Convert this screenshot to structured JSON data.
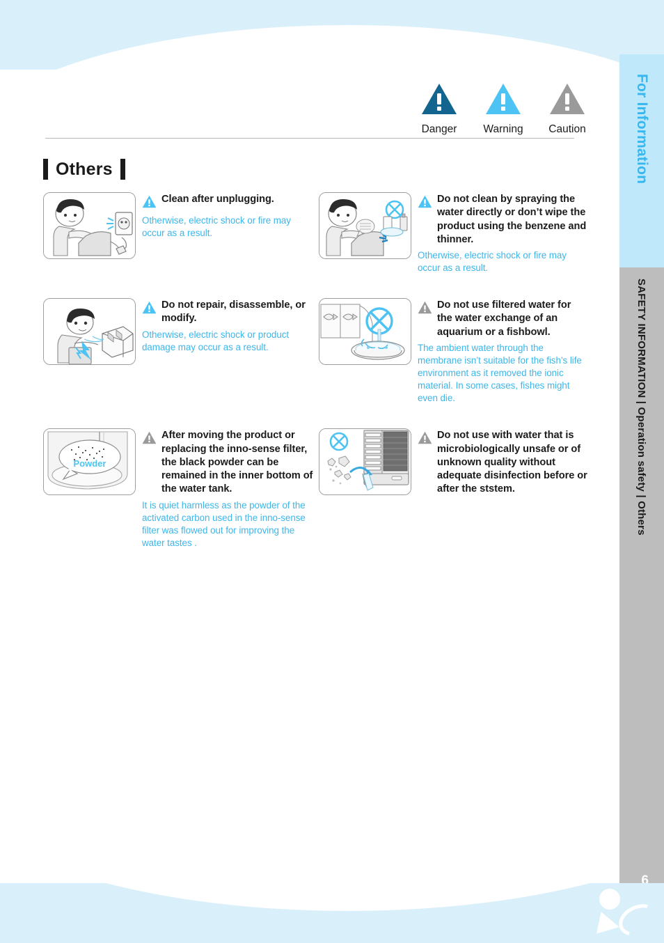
{
  "legend": {
    "items": [
      {
        "label": "Danger",
        "color": "#13648f",
        "icon": "danger-triangle-icon"
      },
      {
        "label": "Warning",
        "color": "#4cc3f2",
        "icon": "warning-triangle-icon"
      },
      {
        "label": "Caution",
        "color": "#9a9a9a",
        "icon": "caution-triangle-icon"
      }
    ]
  },
  "section": {
    "title": "Others"
  },
  "rail": {
    "top_label": "For Information",
    "bottom_label": "SAFETY INFORMATION | Operation safety | Others",
    "page_number": "6"
  },
  "items": [
    {
      "id": "clean-after-unplugging",
      "level": "warning",
      "level_color": "#4cc3f2",
      "headline": "Clean after unplugging.",
      "subtext": "Otherwise, electric shock or fire may occur as a result.",
      "illustration": "man-unplugging-cord-from-wall-outlet"
    },
    {
      "id": "do-not-clean-by-spraying",
      "level": "warning",
      "level_color": "#4cc3f2",
      "headline": "Do not clean by spraying the water directly or don’t wipe the product using the benzene and thinner.",
      "subtext": "Otherwise, electric shock or fire may occur as a result.",
      "illustration": "man-wiping-product-with-prohibited-benzene-bottles"
    },
    {
      "id": "do-not-repair-disassemble-modify",
      "level": "warning",
      "level_color": "#4cc3f2",
      "headline": "Do not repair, disassemble, or modify.",
      "subtext": "Otherwise, electric shock or product damage may occur as a result.",
      "illustration": "man-with-toolbox-getting-electric-shock"
    },
    {
      "id": "do-not-use-filtered-water-for-aquarium",
      "level": "caution",
      "level_color": "#9a9a9a",
      "headline": "Do not use filtered water for the water exchange of an aquarium or a fishbowl.",
      "subtext": "The ambient water through the membrane isn’t suitable for the fish’s life environment as it removed the ionic material. In some cases, fishes might even die.",
      "illustration": "prohibited-filtered-water-poured-into-fishbowl"
    },
    {
      "id": "black-powder-in-water-tank",
      "level": "caution",
      "level_color": "#9a9a9a",
      "headline": "After moving the product or replacing the inno-sense filter, the black powder can be remained in the inner bottom of the water tank.",
      "subtext": "It is quiet harmless as the powder of the activated carbon used in the inno-sense filter was flowed out for improving the water tastes .",
      "illustration": "water-tank-bottom-with-powder-callout",
      "callout_label": "Powder"
    },
    {
      "id": "do-not-use-microbiologically-unsafe-water",
      "level": "caution",
      "level_color": "#9a9a9a",
      "headline": "Do not use with water that is microbiologically unsafe or of unknown quality without adequate disinfection before or after the ststem.",
      "subtext": "",
      "illustration": "prohibited-unsafe-water-into-purifier"
    }
  ]
}
